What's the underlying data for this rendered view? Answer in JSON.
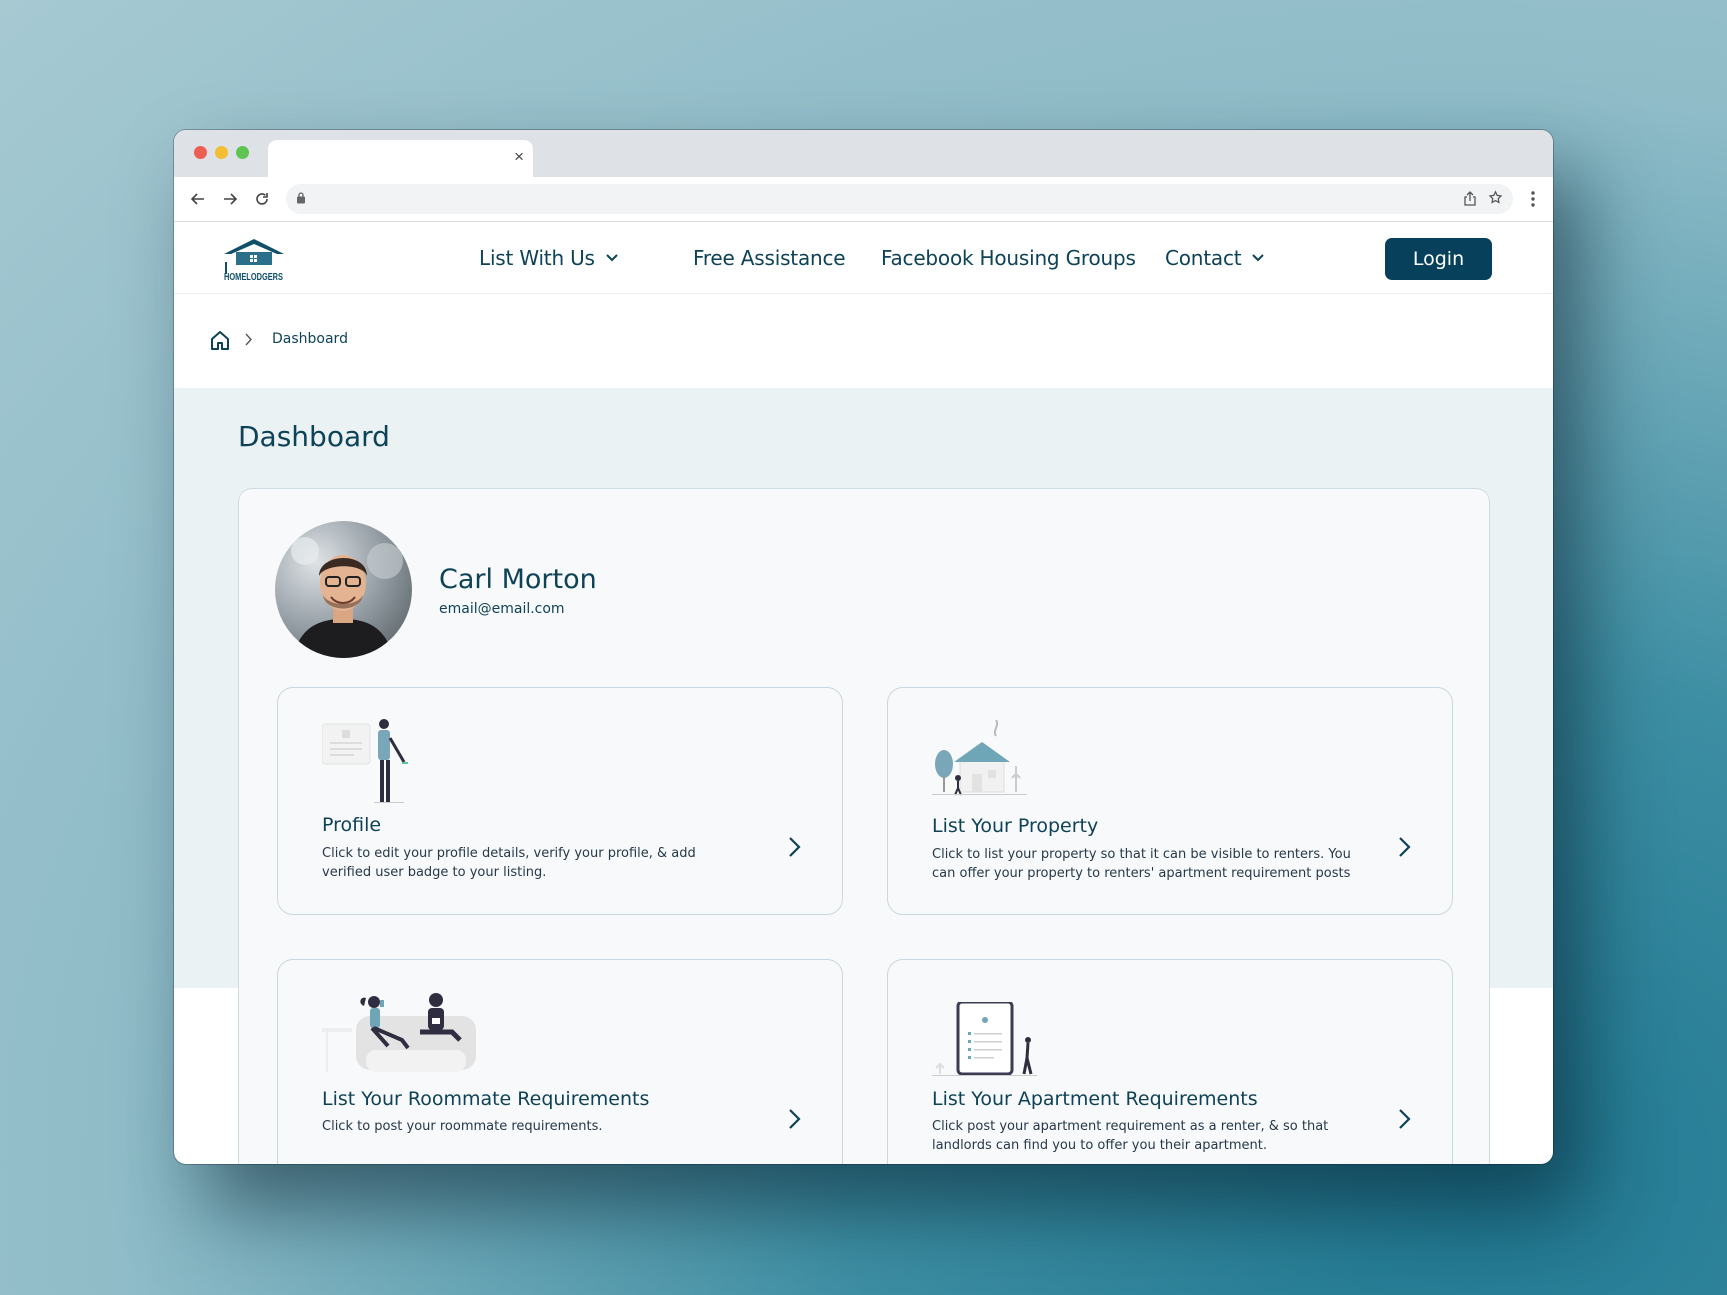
{
  "browser": {
    "tab_close": "×"
  },
  "site": {
    "logo_text": "HOMELODGERS",
    "nav": [
      {
        "label": "List With Us",
        "has_dropdown": true
      },
      {
        "label": "Free Assistance",
        "has_dropdown": false
      },
      {
        "label": "Facebook Housing Groups",
        "has_dropdown": false
      },
      {
        "label": "Contact",
        "has_dropdown": true
      }
    ],
    "login_label": "Login"
  },
  "breadcrumb": {
    "current": "Dashboard"
  },
  "page": {
    "title": "Dashboard"
  },
  "user": {
    "name": "Carl Morton",
    "email": "email@email.com"
  },
  "cards": [
    {
      "title": "Profile",
      "description": "Click to edit your profile details, verify your profile, & add verified user badge to your listing."
    },
    {
      "title": "List Your Property",
      "description": "Click to list your property so that it can be visible to renters. You can offer your property to renters' apartment requirement posts"
    },
    {
      "title": "List Your Roommate Requirements",
      "description": "Click to post your roommate requirements."
    },
    {
      "title": "List Your Apartment Requirements",
      "description": "Click post your apartment requirement as a renter, & so that landlords can find you to offer you their apartment."
    }
  ],
  "colors": {
    "brand": "#06405a",
    "text": "#0e4257",
    "background": "#ebf2f4"
  }
}
